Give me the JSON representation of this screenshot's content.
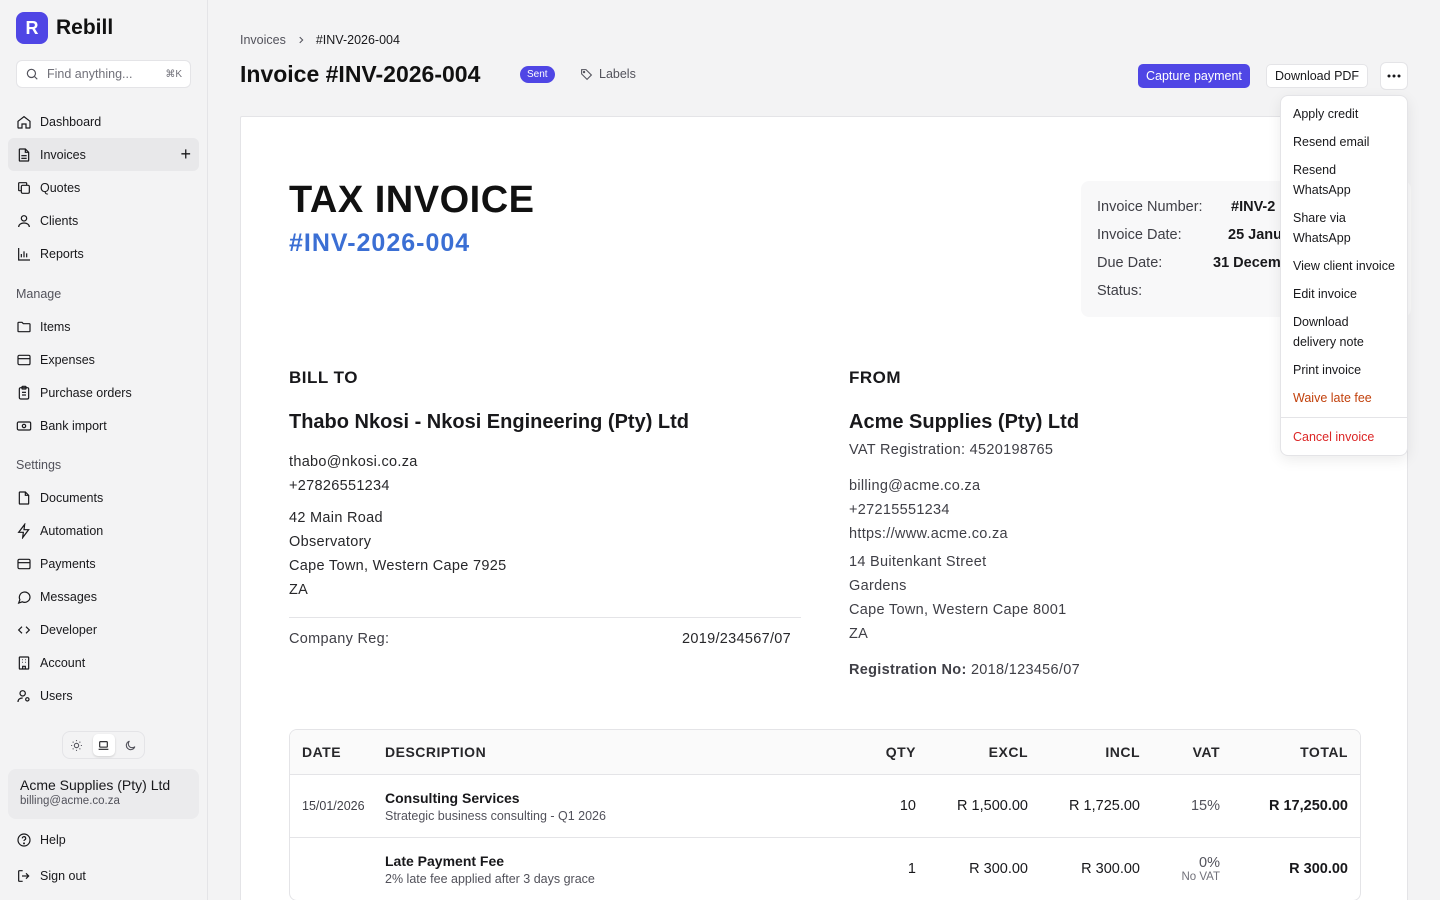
{
  "brand": {
    "logo_letter": "R",
    "name": "Rebill"
  },
  "search": {
    "placeholder": "Find anything...",
    "shortcut": "⌘K"
  },
  "sidebar": {
    "primary": [
      {
        "label": "Dashboard",
        "icon": "home-icon"
      },
      {
        "label": "Invoices",
        "icon": "document-icon",
        "active": true
      },
      {
        "label": "Quotes",
        "icon": "copy-icon"
      },
      {
        "label": "Clients",
        "icon": "user-icon"
      },
      {
        "label": "Reports",
        "icon": "chart-icon"
      }
    ],
    "manage_title": "Manage",
    "manage": [
      {
        "label": "Items",
        "icon": "folder-icon"
      },
      {
        "label": "Expenses",
        "icon": "card-icon"
      },
      {
        "label": "Purchase orders",
        "icon": "clipboard-icon"
      },
      {
        "label": "Bank import",
        "icon": "banknote-icon"
      }
    ],
    "settings_title": "Settings",
    "settings": [
      {
        "label": "Documents",
        "icon": "document-icon"
      },
      {
        "label": "Automation",
        "icon": "zap-icon"
      },
      {
        "label": "Payments",
        "icon": "card-icon"
      },
      {
        "label": "Messages",
        "icon": "chat-icon"
      },
      {
        "label": "Developer",
        "icon": "code-icon"
      },
      {
        "label": "Account",
        "icon": "building-icon"
      },
      {
        "label": "Users",
        "icon": "users-icon"
      }
    ],
    "account": {
      "name": "Acme Supplies (Pty) Ltd",
      "email": "billing@acme.co.za"
    },
    "help": "Help",
    "sign_out": "Sign out"
  },
  "breadcrumb": {
    "parent": "Invoices",
    "current": "#INV-2026-004"
  },
  "header": {
    "title": "Invoice #INV-2026-004",
    "status": "Sent",
    "labels": "Labels",
    "capture_payment": "Capture payment",
    "download_pdf": "Download PDF"
  },
  "invoice": {
    "title": "TAX INVOICE",
    "number": "#INV-2026-004",
    "meta": {
      "number_label": "Invoice Number:",
      "number_value": "#INV-2",
      "date_label": "Invoice Date:",
      "date_value": "25 Janu",
      "due_label": "Due Date:",
      "due_value": "31 Decem",
      "status_label": "Status:"
    },
    "bill_to": {
      "heading": "BILL TO",
      "name": "Thabo Nkosi - Nkosi Engineering (Pty) Ltd",
      "email": "thabo@nkosi.co.za",
      "phone": "+27826551234",
      "address": [
        "42 Main Road",
        "Observatory",
        "Cape Town, Western Cape 7925",
        "ZA"
      ],
      "reg_label": "Company Reg:",
      "reg_value": "2019/234567/07"
    },
    "from": {
      "heading": "FROM",
      "name": "Acme Supplies (Pty) Ltd",
      "vat": "VAT Registration: 4520198765",
      "email": "billing@acme.co.za",
      "phone": "+27215551234",
      "website": "https://www.acme.co.za",
      "address": [
        "14 Buitenkant Street",
        "Gardens",
        "Cape Town, Western Cape 8001",
        "ZA"
      ],
      "reg_label": "Registration No:",
      "reg_value": "2018/123456/07"
    },
    "table": {
      "headers": [
        "DATE",
        "DESCRIPTION",
        "QTY",
        "EXCL",
        "INCL",
        "VAT",
        "TOTAL"
      ],
      "rows": [
        {
          "date": "15/01/2026",
          "name": "Consulting Services",
          "sub": "Strategic business consulting - Q1 2026",
          "qty": "10",
          "excl": "R 1,500.00",
          "incl": "R 1,725.00",
          "vat": "15%",
          "vat_sub": "",
          "total": "R 17,250.00"
        },
        {
          "date": "",
          "name": "Late Payment Fee",
          "sub": "2% late fee applied after 3 days grace",
          "qty": "1",
          "excl": "R 300.00",
          "incl": "R 300.00",
          "vat": "0%",
          "vat_sub": "No VAT",
          "total": "R 300.00"
        }
      ]
    }
  },
  "menu": {
    "items": [
      "Apply credit",
      "Resend email",
      "Resend WhatsApp",
      "Share via WhatsApp",
      "View client invoice",
      "Edit invoice",
      "Download delivery note",
      "Print invoice"
    ],
    "waive": "Waive late fee",
    "cancel": "Cancel invoice"
  },
  "colors": {
    "accent": "#4f46e5",
    "link": "#3b6fd4",
    "warn": "#c2410c",
    "danger": "#dc2626"
  }
}
